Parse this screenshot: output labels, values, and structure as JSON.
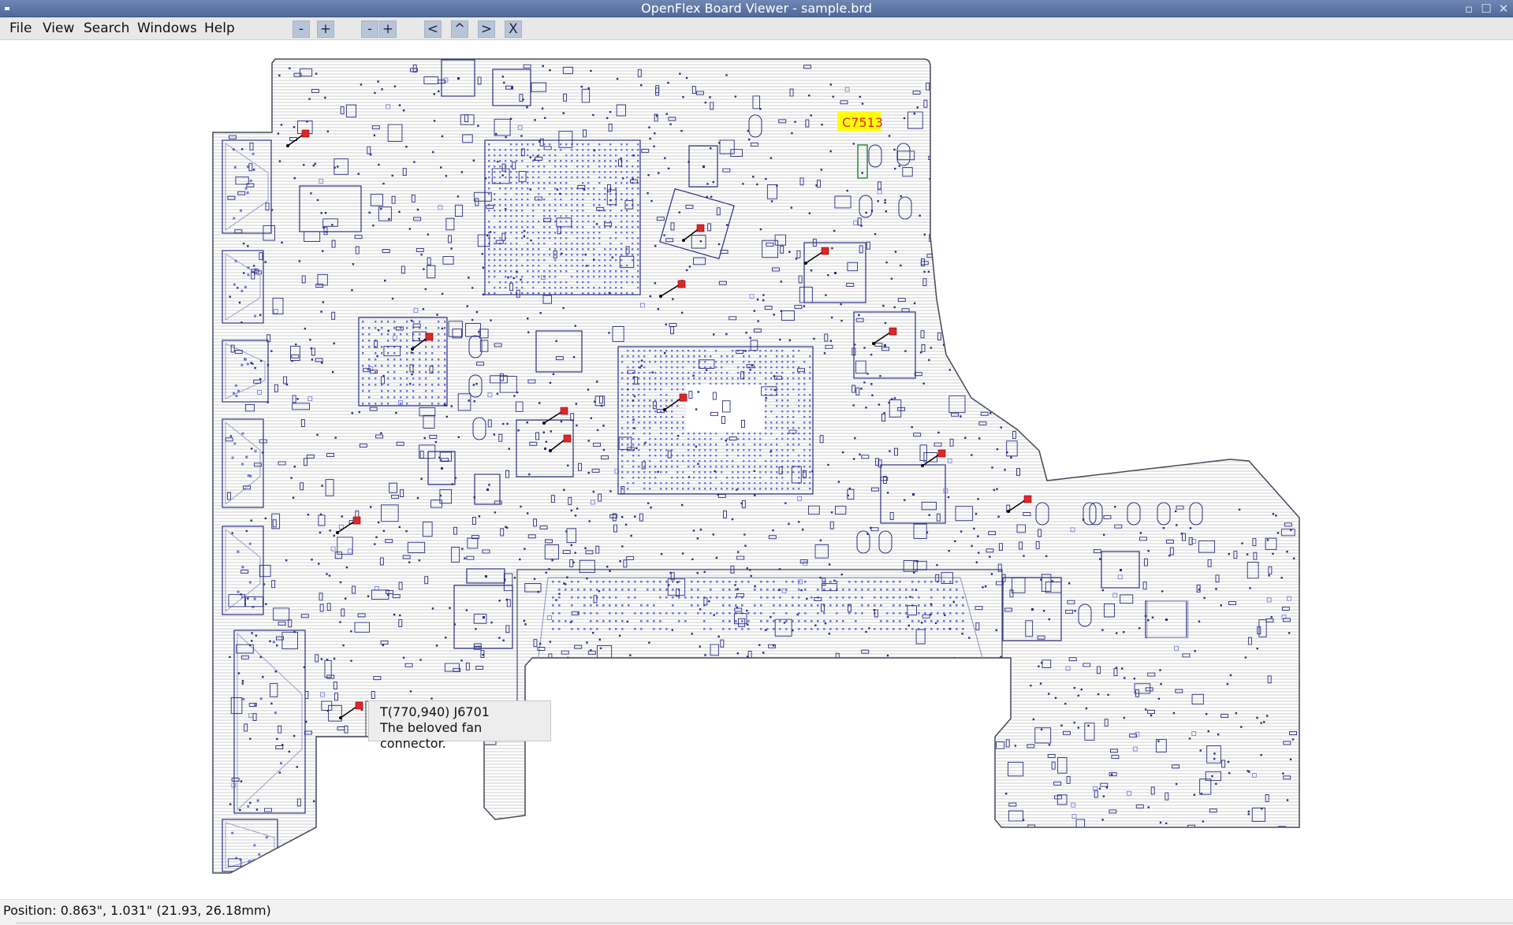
{
  "window": {
    "title": "OpenFlex Board Viewer - sample.brd"
  },
  "menu": {
    "items": [
      "File",
      "View",
      "Search",
      "Windows",
      "Help"
    ]
  },
  "toolbar": {
    "buttons": [
      "-",
      "+",
      "-",
      "+",
      "<",
      "^",
      ">",
      "X"
    ]
  },
  "board": {
    "highlight_label": "C7513",
    "colors": {
      "outline": "#444a5a",
      "trace_lines": "#cccccc",
      "component": "#2a2f82",
      "pin": "#6f77dd",
      "marker": "#e0262a",
      "highlight_bg": "#ffff00",
      "highlight_text": "#e0262a"
    }
  },
  "tooltip": {
    "line1": "T(770,940)  J6701",
    "line2": "The beloved fan connector."
  },
  "status": {
    "position_text": "Position: 0.863\", 1.031\" (21.93, 26.18mm)"
  }
}
